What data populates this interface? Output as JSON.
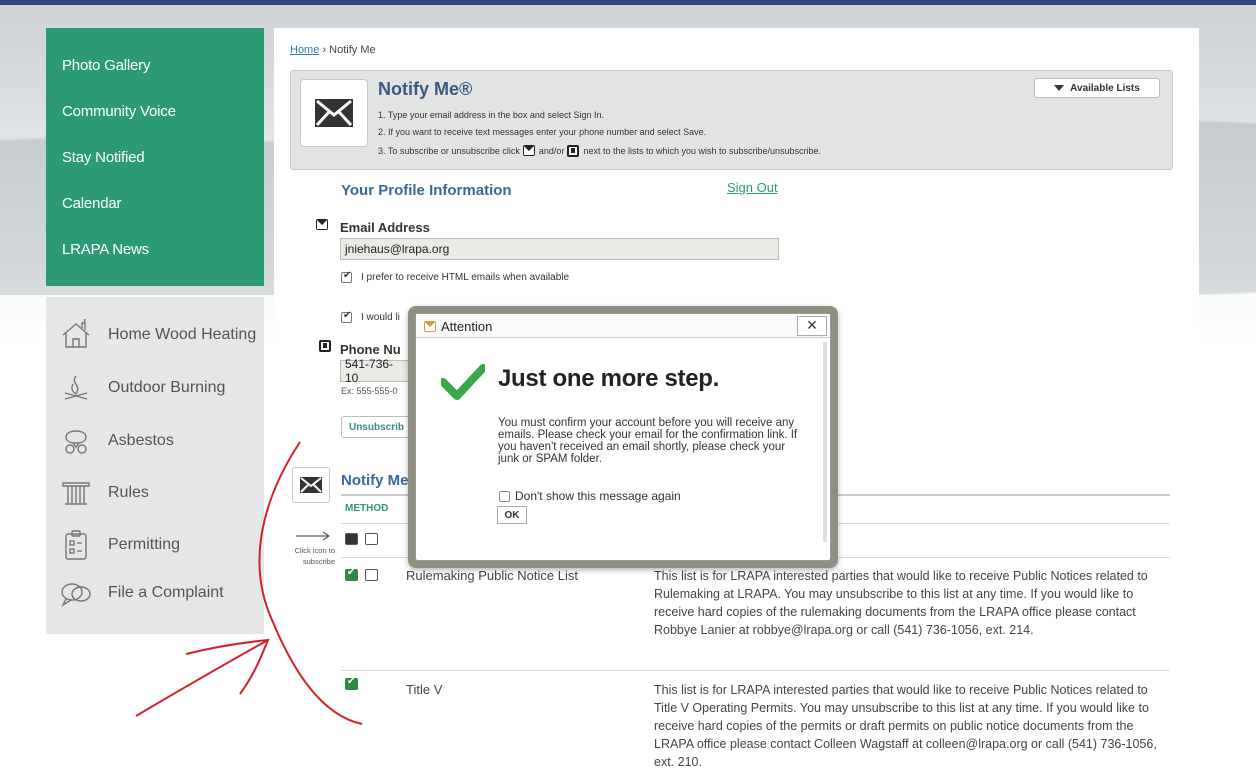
{
  "colors": {
    "nav_green": "#2c9b73",
    "nav_grey": "#e4e6e7",
    "title_blue": "#3a6898",
    "accent_green": "#2c9b73",
    "annotation_red": "#d4202a"
  },
  "nav_primary": [
    {
      "label": "Photo Gallery"
    },
    {
      "label": "Community Voice"
    },
    {
      "label": "Stay Notified"
    },
    {
      "label": "Calendar"
    },
    {
      "label": "LRAPA News"
    }
  ],
  "nav_secondary": [
    {
      "label": "Home Wood Heating",
      "icon": "house-smoke-icon"
    },
    {
      "label": "Outdoor Burning",
      "icon": "campfire-icon"
    },
    {
      "label": "Asbestos",
      "icon": "respirator-icon"
    },
    {
      "label": "Rules",
      "icon": "column-icon"
    },
    {
      "label": "Permitting",
      "icon": "clipboard-icon"
    },
    {
      "label": "File a Complaint",
      "icon": "speech-bubbles-icon"
    }
  ],
  "breadcrumb": {
    "home": "Home",
    "separator": "›",
    "current": "Notify Me"
  },
  "notify_box": {
    "title": "Notify Me®",
    "available_lists": "Available Lists",
    "step1": "1. Type your email address in the box and select Sign In.",
    "step2": "2. If you want to receive text messages enter your phone number and select Save.",
    "step3": "3. To subscribe or unsubscribe click",
    "step3_and": "and/or",
    "step3_rest": "next to the lists to which you wish to subscribe/unsubscribe."
  },
  "profile": {
    "title": "Your Profile Information",
    "sign_out": "Sign Out",
    "email_label": "Email Address",
    "email_value": "jniehaus@lrapa.org",
    "html_pref": "I prefer to receive HTML emails when available",
    "second_pref_partial": "I would li",
    "phone_label_partial": "Phone Nu",
    "phone_value_partial": "541-736-10",
    "phone_hint_partial": "Ex: 555-555-0",
    "unsubscribe_partial": "Unsubscrib"
  },
  "lists": {
    "section_title_partial": "Notify Me",
    "method_header": "METHOD",
    "click_hint": "Click icon to subscribe",
    "rows": [
      {
        "name": "Rulemaking Public Notice List",
        "description": "This list is for LRAPA interested parties that would like to receive Public Notices related to Rulemaking at LRAPA. You may unsubscribe to this list at any time. If you would like to receive hard copies of the rulemaking documents from the LRAPA office please contact Robbye Lanier at robbye@lrapa.org or call (541) 736-1056, ext. 214."
      },
      {
        "name": "Title V",
        "description": "This list is for LRAPA interested parties that would like to receive Public Notices related to Title V Operating Permits. You may unsubscribe to this list at any time. If you would like to receive hard copies of the permits or draft permits on public notice documents from the LRAPA office please contact Colleen Wagstaff at colleen@lrapa.org or call (541) 736-1056, ext. 210."
      }
    ]
  },
  "modal": {
    "title": "Attention",
    "close": "×",
    "heading": "Just one more step.",
    "body": "You must confirm your account before you will receive any emails. Please check your email for the confirmation link. If you haven't received an email shortly, please check your junk or SPAM folder.",
    "dont_show": "Don't show this message again",
    "ok": "OK"
  }
}
